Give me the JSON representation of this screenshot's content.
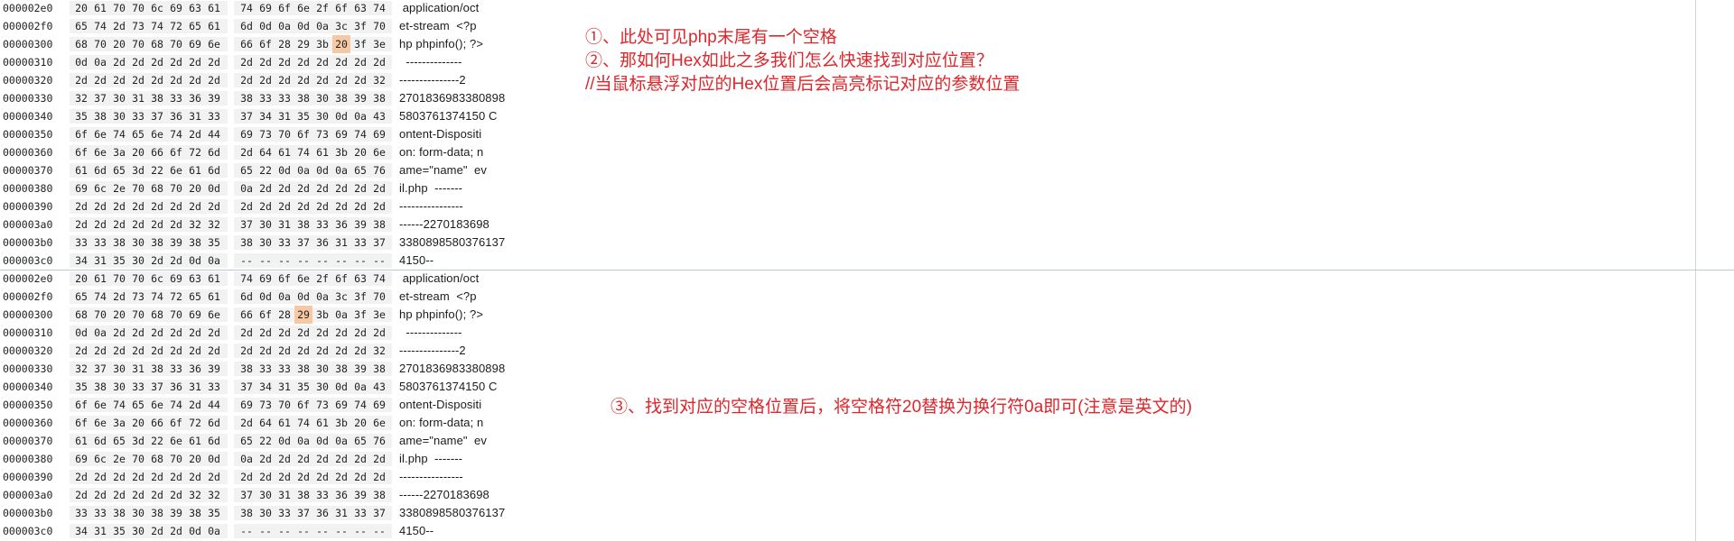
{
  "top_panel": {
    "rows": [
      {
        "offset": "000002e0",
        "bytes": [
          "20",
          "61",
          "70",
          "70",
          "6c",
          "69",
          "63",
          "61",
          "74",
          "69",
          "6f",
          "6e",
          "2f",
          "6f",
          "63",
          "74"
        ],
        "ascii": " application/oct"
      },
      {
        "offset": "000002f0",
        "bytes": [
          "65",
          "74",
          "2d",
          "73",
          "74",
          "72",
          "65",
          "61",
          "6d",
          "0d",
          "0a",
          "0d",
          "0a",
          "3c",
          "3f",
          "70"
        ],
        "ascii": "et-stream  <?p"
      },
      {
        "offset": "00000300",
        "bytes": [
          "68",
          "70",
          "20",
          "70",
          "68",
          "70",
          "69",
          "6e",
          "66",
          "6f",
          "28",
          "29",
          "3b",
          "20",
          "3f",
          "3e"
        ],
        "ascii": "hp phpinfo(); ?>",
        "highlight_index": 13
      },
      {
        "offset": "00000310",
        "bytes": [
          "0d",
          "0a",
          "2d",
          "2d",
          "2d",
          "2d",
          "2d",
          "2d",
          "2d",
          "2d",
          "2d",
          "2d",
          "2d",
          "2d",
          "2d",
          "2d"
        ],
        "ascii": "  --------------"
      },
      {
        "offset": "00000320",
        "bytes": [
          "2d",
          "2d",
          "2d",
          "2d",
          "2d",
          "2d",
          "2d",
          "2d",
          "2d",
          "2d",
          "2d",
          "2d",
          "2d",
          "2d",
          "2d",
          "32"
        ],
        "ascii": "---------------2"
      },
      {
        "offset": "00000330",
        "bytes": [
          "32",
          "37",
          "30",
          "31",
          "38",
          "33",
          "36",
          "39",
          "38",
          "33",
          "33",
          "38",
          "30",
          "38",
          "39",
          "38"
        ],
        "ascii": "2701836983380898"
      },
      {
        "offset": "00000340",
        "bytes": [
          "35",
          "38",
          "30",
          "33",
          "37",
          "36",
          "31",
          "33",
          "37",
          "34",
          "31",
          "35",
          "30",
          "0d",
          "0a",
          "43"
        ],
        "ascii": "5803761374150 C"
      },
      {
        "offset": "00000350",
        "bytes": [
          "6f",
          "6e",
          "74",
          "65",
          "6e",
          "74",
          "2d",
          "44",
          "69",
          "73",
          "70",
          "6f",
          "73",
          "69",
          "74",
          "69"
        ],
        "ascii": "ontent-Dispositi"
      },
      {
        "offset": "00000360",
        "bytes": [
          "6f",
          "6e",
          "3a",
          "20",
          "66",
          "6f",
          "72",
          "6d",
          "2d",
          "64",
          "61",
          "74",
          "61",
          "3b",
          "20",
          "6e"
        ],
        "ascii": "on: form-data; n"
      },
      {
        "offset": "00000370",
        "bytes": [
          "61",
          "6d",
          "65",
          "3d",
          "22",
          "6e",
          "61",
          "6d",
          "65",
          "22",
          "0d",
          "0a",
          "0d",
          "0a",
          "65",
          "76"
        ],
        "ascii": "ame=\"name\"  ev"
      },
      {
        "offset": "00000380",
        "bytes": [
          "69",
          "6c",
          "2e",
          "70",
          "68",
          "70",
          "20",
          "0d",
          "0a",
          "2d",
          "2d",
          "2d",
          "2d",
          "2d",
          "2d",
          "2d"
        ],
        "ascii": "il.php  -------"
      },
      {
        "offset": "00000390",
        "bytes": [
          "2d",
          "2d",
          "2d",
          "2d",
          "2d",
          "2d",
          "2d",
          "2d",
          "2d",
          "2d",
          "2d",
          "2d",
          "2d",
          "2d",
          "2d",
          "2d"
        ],
        "ascii": "----------------"
      },
      {
        "offset": "000003a0",
        "bytes": [
          "2d",
          "2d",
          "2d",
          "2d",
          "2d",
          "2d",
          "32",
          "32",
          "37",
          "30",
          "31",
          "38",
          "33",
          "36",
          "39",
          "38"
        ],
        "ascii": "------2270183698"
      },
      {
        "offset": "000003b0",
        "bytes": [
          "33",
          "33",
          "38",
          "30",
          "38",
          "39",
          "38",
          "35",
          "38",
          "30",
          "33",
          "37",
          "36",
          "31",
          "33",
          "37"
        ],
        "ascii": "3380898580376137"
      },
      {
        "offset": "000003c0",
        "bytes": [
          "34",
          "31",
          "35",
          "30",
          "2d",
          "2d",
          "0d",
          "0a",
          "--",
          "--",
          "--",
          "--",
          "--",
          "--",
          "--",
          "--"
        ],
        "ascii": "4150--"
      }
    ],
    "notes": [
      "①、此处可见php末尾有一个空格",
      "②、那如何Hex如此之多我们怎么快速找到对应位置？",
      "//当鼠标悬浮对应的Hex位置后会高亮标记对应的参数位置"
    ]
  },
  "bottom_panel": {
    "rows": [
      {
        "offset": "000002e0",
        "bytes": [
          "20",
          "61",
          "70",
          "70",
          "6c",
          "69",
          "63",
          "61",
          "74",
          "69",
          "6f",
          "6e",
          "2f",
          "6f",
          "63",
          "74"
        ],
        "ascii": " application/oct"
      },
      {
        "offset": "000002f0",
        "bytes": [
          "65",
          "74",
          "2d",
          "73",
          "74",
          "72",
          "65",
          "61",
          "6d",
          "0d",
          "0a",
          "0d",
          "0a",
          "3c",
          "3f",
          "70"
        ],
        "ascii": "et-stream  <?p"
      },
      {
        "offset": "00000300",
        "bytes": [
          "68",
          "70",
          "20",
          "70",
          "68",
          "70",
          "69",
          "6e",
          "66",
          "6f",
          "28",
          "29",
          "3b",
          "0a",
          "3f",
          "3e"
        ],
        "ascii": "hp phpinfo(); ?>",
        "highlight_index": 11
      },
      {
        "offset": "00000310",
        "bytes": [
          "0d",
          "0a",
          "2d",
          "2d",
          "2d",
          "2d",
          "2d",
          "2d",
          "2d",
          "2d",
          "2d",
          "2d",
          "2d",
          "2d",
          "2d",
          "2d"
        ],
        "ascii": "  --------------"
      },
      {
        "offset": "00000320",
        "bytes": [
          "2d",
          "2d",
          "2d",
          "2d",
          "2d",
          "2d",
          "2d",
          "2d",
          "2d",
          "2d",
          "2d",
          "2d",
          "2d",
          "2d",
          "2d",
          "32"
        ],
        "ascii": "---------------2"
      },
      {
        "offset": "00000330",
        "bytes": [
          "32",
          "37",
          "30",
          "31",
          "38",
          "33",
          "36",
          "39",
          "38",
          "33",
          "33",
          "38",
          "30",
          "38",
          "39",
          "38"
        ],
        "ascii": "2701836983380898"
      },
      {
        "offset": "00000340",
        "bytes": [
          "35",
          "38",
          "30",
          "33",
          "37",
          "36",
          "31",
          "33",
          "37",
          "34",
          "31",
          "35",
          "30",
          "0d",
          "0a",
          "43"
        ],
        "ascii": "5803761374150 C"
      },
      {
        "offset": "00000350",
        "bytes": [
          "6f",
          "6e",
          "74",
          "65",
          "6e",
          "74",
          "2d",
          "44",
          "69",
          "73",
          "70",
          "6f",
          "73",
          "69",
          "74",
          "69"
        ],
        "ascii": "ontent-Dispositi"
      },
      {
        "offset": "00000360",
        "bytes": [
          "6f",
          "6e",
          "3a",
          "20",
          "66",
          "6f",
          "72",
          "6d",
          "2d",
          "64",
          "61",
          "74",
          "61",
          "3b",
          "20",
          "6e"
        ],
        "ascii": "on: form-data; n"
      },
      {
        "offset": "00000370",
        "bytes": [
          "61",
          "6d",
          "65",
          "3d",
          "22",
          "6e",
          "61",
          "6d",
          "65",
          "22",
          "0d",
          "0a",
          "0d",
          "0a",
          "65",
          "76"
        ],
        "ascii": "ame=\"name\"  ev"
      },
      {
        "offset": "00000380",
        "bytes": [
          "69",
          "6c",
          "2e",
          "70",
          "68",
          "70",
          "20",
          "0d",
          "0a",
          "2d",
          "2d",
          "2d",
          "2d",
          "2d",
          "2d",
          "2d"
        ],
        "ascii": "il.php  -------"
      },
      {
        "offset": "00000390",
        "bytes": [
          "2d",
          "2d",
          "2d",
          "2d",
          "2d",
          "2d",
          "2d",
          "2d",
          "2d",
          "2d",
          "2d",
          "2d",
          "2d",
          "2d",
          "2d",
          "2d"
        ],
        "ascii": "----------------"
      },
      {
        "offset": "000003a0",
        "bytes": [
          "2d",
          "2d",
          "2d",
          "2d",
          "2d",
          "2d",
          "32",
          "32",
          "37",
          "30",
          "31",
          "38",
          "33",
          "36",
          "39",
          "38"
        ],
        "ascii": "------2270183698"
      },
      {
        "offset": "000003b0",
        "bytes": [
          "33",
          "33",
          "38",
          "30",
          "38",
          "39",
          "38",
          "35",
          "38",
          "30",
          "33",
          "37",
          "36",
          "31",
          "33",
          "37"
        ],
        "ascii": "3380898580376137"
      },
      {
        "offset": "000003c0",
        "bytes": [
          "34",
          "31",
          "35",
          "30",
          "2d",
          "2d",
          "0d",
          "0a",
          "--",
          "--",
          "--",
          "--",
          "--",
          "--",
          "--",
          "--"
        ],
        "ascii": "4150--"
      }
    ],
    "notes": [
      "③、找到对应的空格位置后，将空格符20替换为换行符0a即可(注意是英文的)"
    ]
  },
  "colors": {
    "annotation": "#e0262a",
    "byte_highlight": "#f6c8a3",
    "byte_group_bg": "#f2f2f2",
    "divider": "#b9c9dd"
  }
}
